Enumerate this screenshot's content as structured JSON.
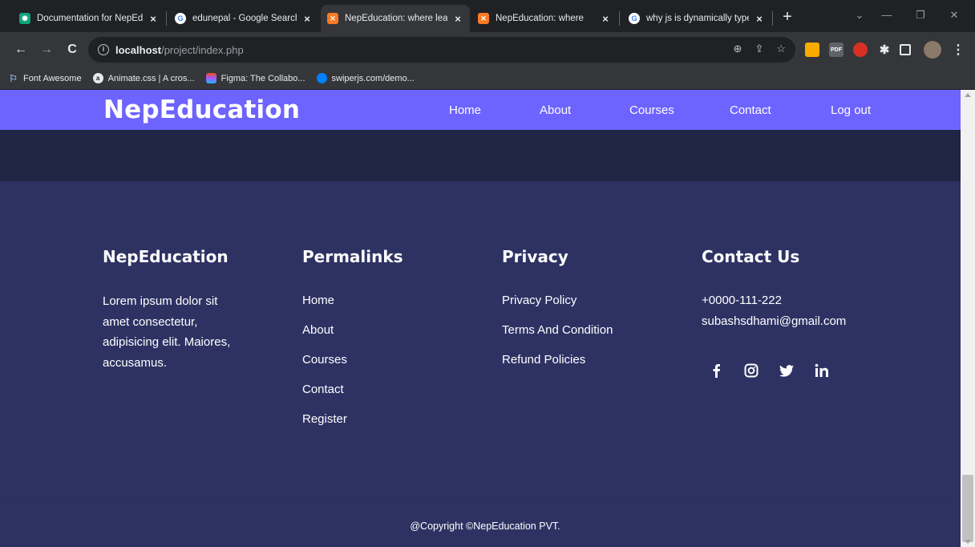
{
  "browser": {
    "tabs": [
      {
        "title": "Documentation for NepEd",
        "favicon": "gpt-icon",
        "active": false
      },
      {
        "title": "edunepal - Google Search",
        "favicon": "google-icon",
        "active": false
      },
      {
        "title": "NepEducation: where lear",
        "favicon": "xampp-icon",
        "active": true
      },
      {
        "title": "NepEducation: where",
        "favicon": "xampp-icon",
        "active": false
      },
      {
        "title": "why js is dynamically type",
        "favicon": "google-icon",
        "active": false
      }
    ],
    "url_host": "localhost",
    "url_path": "/project/index.php",
    "bookmarks": [
      {
        "label": "Font Awesome",
        "icon": "flag-icon"
      },
      {
        "label": "Animate.css | A cros...",
        "icon": "animate-icon"
      },
      {
        "label": "Figma: The Collabo...",
        "icon": "figma-icon"
      },
      {
        "label": "swiperjs.com/demo...",
        "icon": "swiper-icon"
      }
    ]
  },
  "site": {
    "brand": "NepEducation",
    "nav": [
      "Home",
      "About",
      "Courses",
      "Contact",
      "Log out"
    ],
    "colors": {
      "navbar": "#6d63fe",
      "footer": "#2e3263",
      "band": "#202543"
    }
  },
  "footer": {
    "about": {
      "heading": "NepEducation",
      "text": "Lorem ipsum dolor sit amet consectetur, adipisicing elit. Maiores, accusamus."
    },
    "permalinks": {
      "heading": "Permalinks",
      "links": [
        "Home",
        "About",
        "Courses",
        "Contact",
        "Register"
      ]
    },
    "privacy": {
      "heading": "Privacy",
      "links": [
        "Privacy Policy",
        "Terms And Condition",
        "Refund Policies"
      ]
    },
    "contact": {
      "heading": "Contact Us",
      "phone": "+0000-111-222",
      "email": "subashsdhami@gmail.com",
      "socials": [
        "facebook-icon",
        "instagram-icon",
        "twitter-icon",
        "linkedin-icon"
      ]
    },
    "copyright": "@Copyright ©NepEducation PVT."
  }
}
